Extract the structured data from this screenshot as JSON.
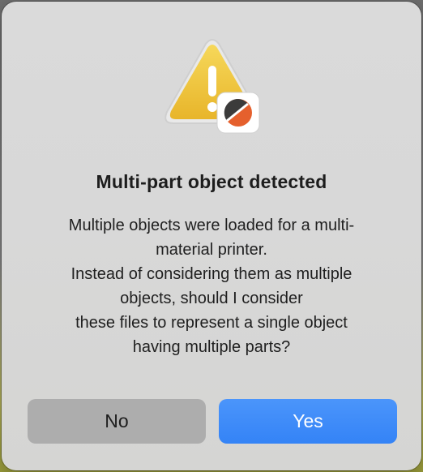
{
  "dialog": {
    "title": "Multi-part object detected",
    "message_lines": [
      "Multiple objects were loaded for a multi-",
      "material printer.",
      "Instead of considering them as multiple",
      "objects, should I consider",
      "these files to represent a single object",
      "having multiple parts?"
    ],
    "buttons": {
      "no_label": "No",
      "yes_label": "Yes"
    },
    "icon": "warning-icon",
    "badge_icon": "app-logo-icon"
  },
  "colors": {
    "primary_button": "#3483f6",
    "secondary_button": "#adadad",
    "warning_yellow": "#f0c63a",
    "logo_orange": "#e5602d"
  }
}
